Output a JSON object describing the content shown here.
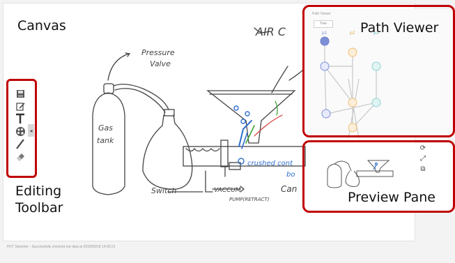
{
  "labels": {
    "canvas": "Canvas",
    "path_viewer": "Path Viewer",
    "editing_toolbar_line1": "Editing",
    "editing_toolbar_line2": "Toolbar",
    "preview_pane": "Preview Pane"
  },
  "sketch_text": {
    "air": "AIR C",
    "pressure_valve_line1": "Pressure",
    "pressure_valve_line2": "Valve",
    "gas_tank_line1": "Gas",
    "gas_tank_line2": "tank",
    "switch": "Switch",
    "vacuum": "VACCUM",
    "pump": "PUMP(RETRACT)",
    "can": "Can",
    "crushed": "crushed cont",
    "bo": "bo"
  },
  "path_viewer": {
    "header": "Path Viewer",
    "tab": "Tree",
    "node_labels": [
      "p1",
      "p2",
      "p3"
    ]
  },
  "toolbar": {
    "tools": [
      "save-icon",
      "edit-icon",
      "text-icon",
      "palette-icon",
      "pen-icon",
      "eraser-icon"
    ],
    "collapse_glyph": "◂"
  },
  "preview_pane": {
    "icons": [
      "refresh-icon",
      "fullscreen-icon",
      "copy-icon"
    ],
    "glyphs": [
      "⟳",
      "⤢",
      "⧉"
    ]
  },
  "status_bar": {
    "text": "HVT Sketcher - Successfully checked out data at 2018/09/18 14:56:21"
  },
  "colors": {
    "highlight": "#c00000",
    "node_blue": "#7e8fd8",
    "node_orange": "#f2c27a",
    "node_teal": "#8fd3cf"
  }
}
